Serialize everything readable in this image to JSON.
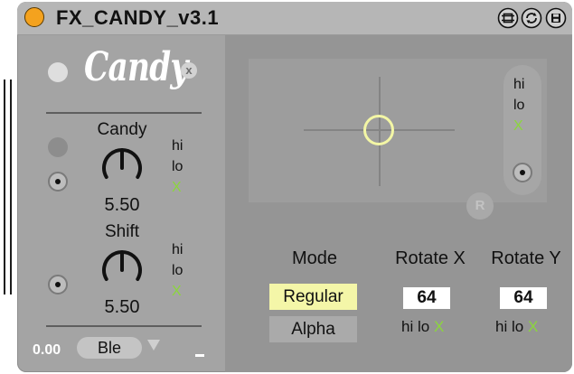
{
  "device": {
    "title": "FX_CANDY_v3.1",
    "logo": "Candy",
    "close_glyph": "x"
  },
  "colors": {
    "power": "#f4a21e",
    "accent_yellow": "#f4f6a8",
    "toggle_green": "#8bd63c",
    "body": "#a4a4a4",
    "right_panel": "#959595"
  },
  "icons": {
    "power": "power-dot-icon",
    "hotswap": "hotswap-icon",
    "refresh": "refresh-icon",
    "save": "save-icon"
  },
  "knobs": {
    "candy": {
      "label": "Candy",
      "value": "5.50",
      "hi": "hi",
      "lo": "lo",
      "x": "X"
    },
    "shift": {
      "label": "Shift",
      "value": "5.50",
      "hi": "hi",
      "lo": "lo",
      "x": "X"
    }
  },
  "bottom": {
    "value": "0.00",
    "selector": "Ble"
  },
  "xy_pad": {
    "hi": "hi",
    "lo": "lo",
    "x": "X",
    "reset": "R"
  },
  "mode": {
    "label": "Mode",
    "options": [
      "Regular",
      "Alpha"
    ],
    "selected": "Regular"
  },
  "rotate_x": {
    "label": "Rotate X",
    "value": "64",
    "hi": "hi",
    "lo": "lo",
    "x": "X"
  },
  "rotate_y": {
    "label": "Rotate Y",
    "value": "64",
    "hi": "hi",
    "lo": "lo",
    "x": "X"
  }
}
